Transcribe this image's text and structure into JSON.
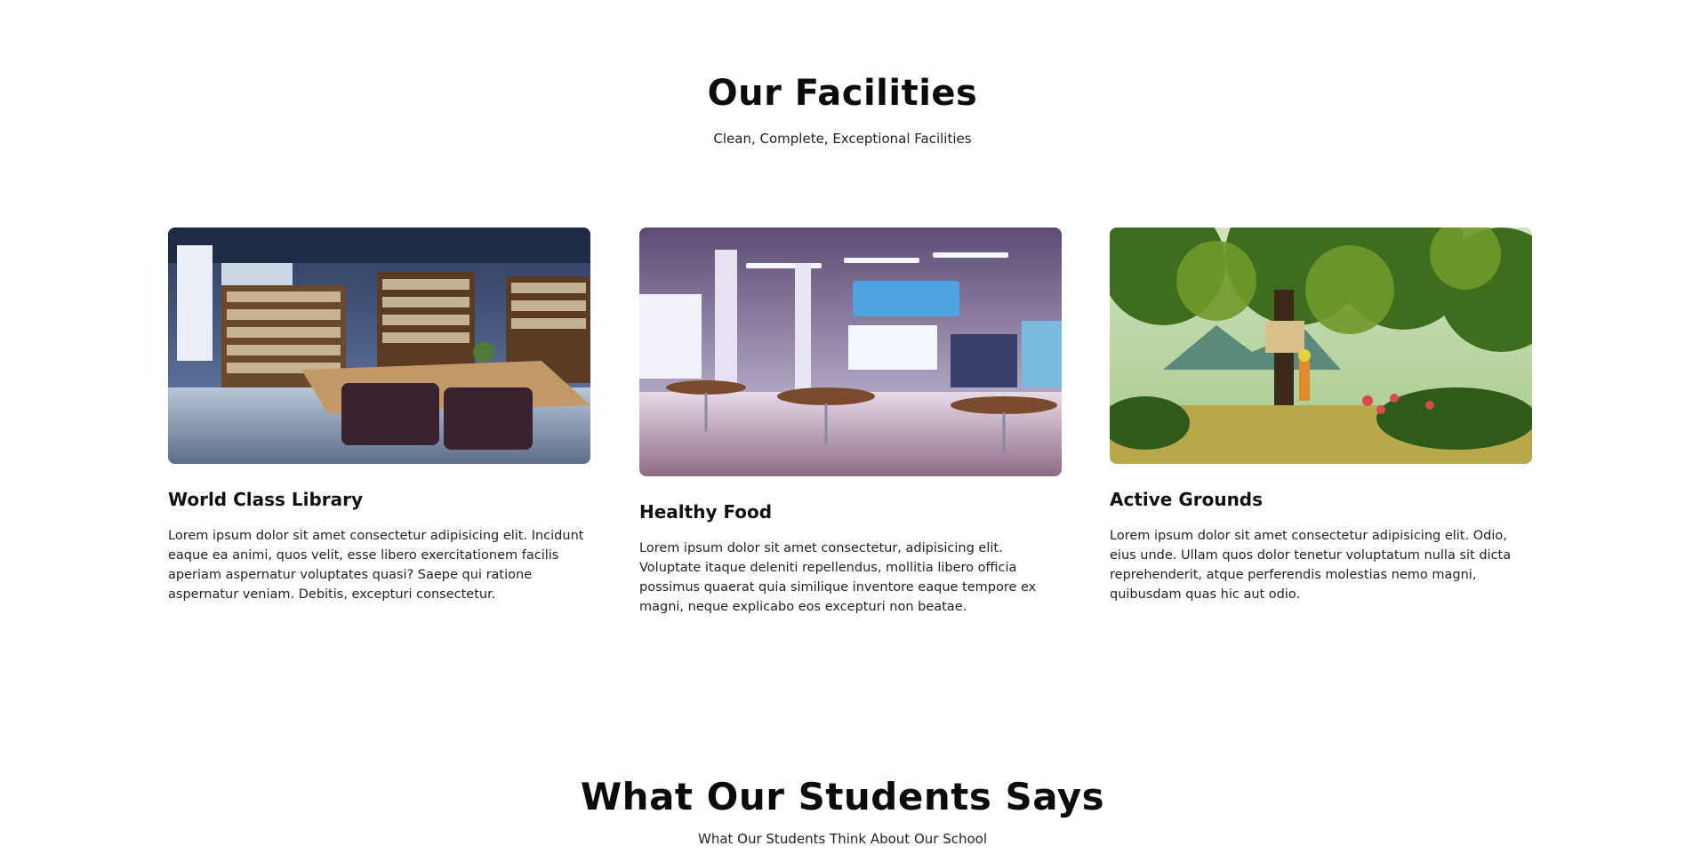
{
  "facilities": {
    "title": "Our Facilities",
    "subtitle": "Clean, Complete, Exceptional Facilities",
    "cards": [
      {
        "image_icon": "library-image",
        "title": "World Class Library",
        "text": "Lorem ipsum dolor sit amet consectetur adipisicing elit. Incidunt eaque ea animi, quos velit, esse libero exercitationem facilis aperiam aspernatur voluptates quasi? Saepe qui ratione aspernatur veniam. Debitis, excepturi consectetur."
      },
      {
        "image_icon": "cafeteria-image",
        "title": "Healthy Food",
        "text": "Lorem ipsum dolor sit amet consectetur, adipisicing elit. Voluptate itaque deleniti repellendus, mollitia libero officia possimus quaerat quia similique inventore eaque tempore ex magni, neque explicabo eos excepturi non beatae."
      },
      {
        "image_icon": "grounds-image",
        "title": "Active Grounds",
        "text": "Lorem ipsum dolor sit amet consectetur adipisicing elit. Odio, eius unde. Ullam quos dolor tenetur voluptatum nulla sit dicta reprehenderit, atque perferendis molestias nemo magni, quibusdam quas hic aut odio."
      }
    ]
  },
  "testimonials": {
    "title": "What Our Students Says",
    "subtitle": "What Our Students Think About Our School"
  }
}
